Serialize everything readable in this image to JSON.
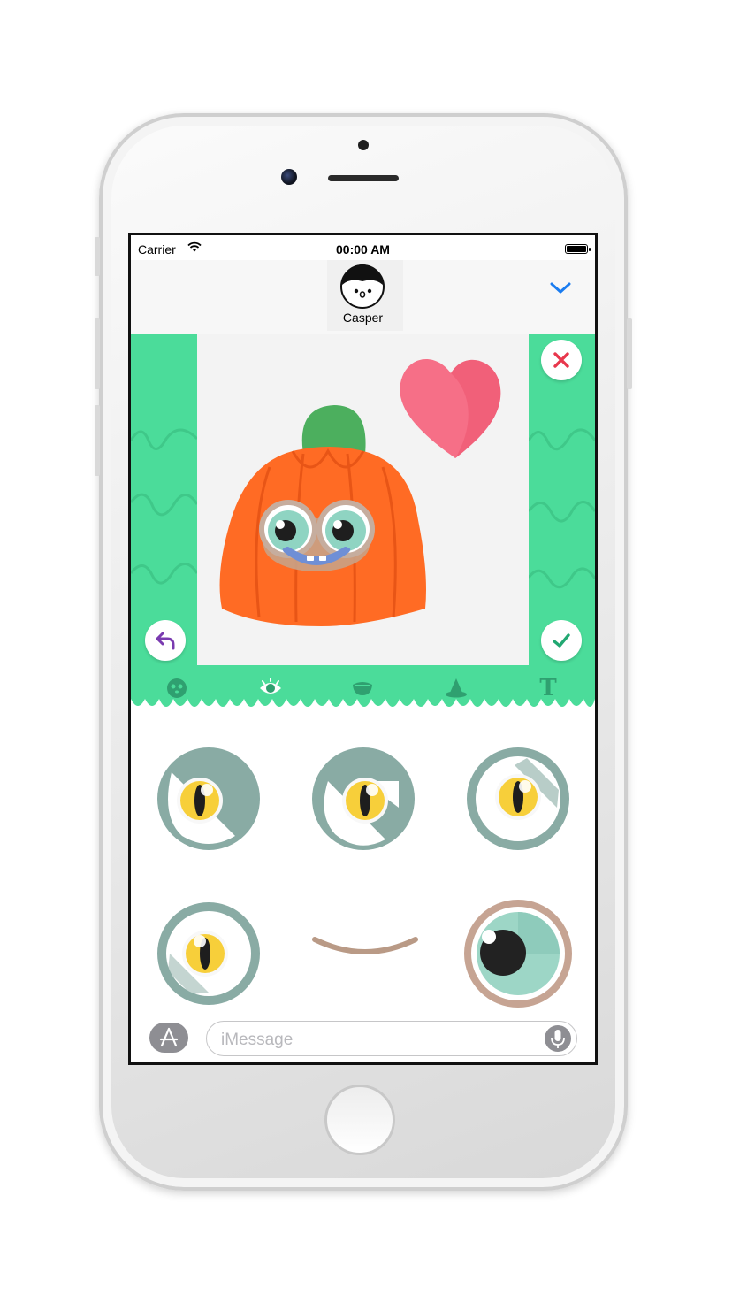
{
  "status_bar": {
    "carrier": "Carrier",
    "time": "00:00 AM",
    "icons": [
      "wifi-icon",
      "battery-icon"
    ]
  },
  "nav": {
    "contact_name": "Casper",
    "icons": [
      "avatar",
      "chevron-down-icon"
    ]
  },
  "editor": {
    "sticker": [
      "pumpkin-monster",
      "heart"
    ],
    "buttons": [
      "close-icon",
      "undo-icon",
      "checkmark-icon"
    ]
  },
  "toolbar": {
    "tabs": [
      "face-icon",
      "eye-icon",
      "mouth-icon",
      "hat-icon",
      "text-tool-icon"
    ],
    "text_tool_label": "T",
    "selected": "eye-icon"
  },
  "picker": {
    "category": "eyes",
    "items": [
      "cat-eye-1",
      "cat-eye-2",
      "cat-eye-3",
      "cat-eye-4",
      "smile-mouth",
      "round-eye"
    ]
  },
  "message_bar": {
    "placeholder": "iMessage",
    "icons": [
      "app-store-icon",
      "microphone-icon"
    ]
  },
  "colors": {
    "green": "#4bdc9a",
    "pumpkin": "#ff6b24",
    "accent_blue": "#1a7cf0",
    "close_red": "#e8374c",
    "confirm_green": "#22a872",
    "undo_purple": "#7a3bb0"
  }
}
